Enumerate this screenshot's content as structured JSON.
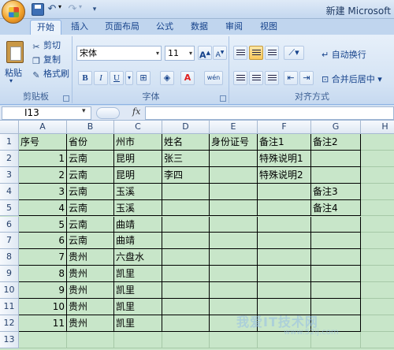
{
  "window": {
    "title": "新建 Microsoft"
  },
  "tabs": [
    "开始",
    "插入",
    "页面布局",
    "公式",
    "数据",
    "审阅",
    "视图"
  ],
  "clipboard": {
    "paste": "粘贴",
    "cut": "剪切",
    "copy": "复制",
    "format_painter": "格式刷",
    "group_label": "剪贴板"
  },
  "font": {
    "name": "宋体",
    "size": "11",
    "grow": "A",
    "shrink": "A",
    "bold": "B",
    "italic": "I",
    "underline": "U",
    "phonetic": "wén",
    "group_label": "字体",
    "color_accent": "#e02020"
  },
  "alignment": {
    "wrap_text": "自动换行",
    "merge_center": "合并后居中",
    "group_label": "对齐方式"
  },
  "formula_bar": {
    "name_box": "I13",
    "fx": "fx",
    "formula": ""
  },
  "columns": [
    "A",
    "B",
    "C",
    "D",
    "E",
    "F",
    "G",
    "H"
  ],
  "rows": [
    "1",
    "2",
    "3",
    "4",
    "5",
    "6",
    "7",
    "8",
    "9",
    "10",
    "11",
    "12",
    "13"
  ],
  "table": {
    "header": [
      "序号",
      "省份",
      "州市",
      "姓名",
      "身份证号",
      "备注1",
      "备注2"
    ],
    "data": [
      [
        "1",
        "云南",
        "昆明",
        "张三",
        "",
        "特殊说明1",
        ""
      ],
      [
        "2",
        "云南",
        "昆明",
        "李四",
        "",
        "特殊说明2",
        ""
      ],
      [
        "3",
        "云南",
        "玉溪",
        "",
        "",
        "",
        "备注3"
      ],
      [
        "4",
        "云南",
        "玉溪",
        "",
        "",
        "",
        "备注4"
      ],
      [
        "5",
        "云南",
        "曲靖",
        "",
        "",
        "",
        ""
      ],
      [
        "6",
        "云南",
        "曲靖",
        "",
        "",
        "",
        ""
      ],
      [
        "7",
        "贵州",
        "六盘水",
        "",
        "",
        "",
        ""
      ],
      [
        "8",
        "贵州",
        "凯里",
        "",
        "",
        "",
        ""
      ],
      [
        "9",
        "贵州",
        "凯里",
        "",
        "",
        "",
        ""
      ],
      [
        "10",
        "贵州",
        "凯里",
        "",
        "",
        "",
        ""
      ],
      [
        "11",
        "贵州",
        "凯里",
        "",
        "",
        "",
        ""
      ]
    ]
  },
  "watermark": {
    "text": "我爱IT技术网",
    "sub": "www.52ij.com"
  },
  "colors": {
    "sheet_background": "#c8e6c9",
    "ribbon": "#dbe7f6",
    "selected_button": "#f9c75a"
  }
}
